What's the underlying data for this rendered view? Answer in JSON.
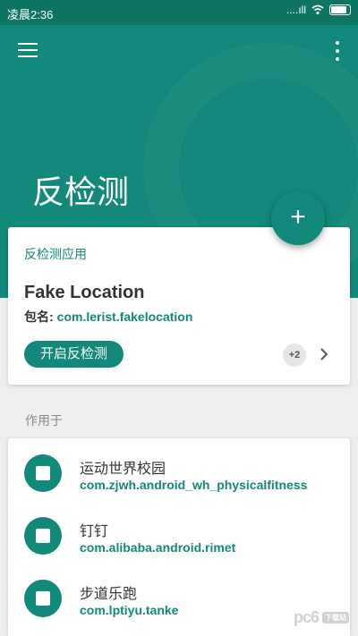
{
  "statusbar": {
    "time": "凌晨2:36",
    "signal": "....ıll",
    "wifi": "wifi-icon",
    "battery": "battery-icon"
  },
  "appbar": {
    "title": "反检测",
    "menu_icon": "menu-icon",
    "more_icon": "more-vertical-icon"
  },
  "fab": {
    "label": "+",
    "icon": "add-icon"
  },
  "main_card": {
    "section_title": "反检测应用",
    "app_name": "Fake Location",
    "package_label": "包名:",
    "package_value": "com.lerist.fakelocation",
    "enable_button": "开启反检测",
    "extra_count": "+2"
  },
  "applies_to": {
    "label": "作用于",
    "items": [
      {
        "name": "运动世界校园",
        "package": "com.zjwh.android_wh_physicalfitness"
      },
      {
        "name": "钉钉",
        "package": "com.alibaba.android.rimet"
      },
      {
        "name": "步道乐跑",
        "package": "com.lptiyu.tanke"
      }
    ]
  },
  "watermark": {
    "text": "pc6",
    "sub": "下载站"
  },
  "colors": {
    "primary": "#12897a",
    "statusbar": "#0e7564",
    "background": "#eeeeee"
  }
}
